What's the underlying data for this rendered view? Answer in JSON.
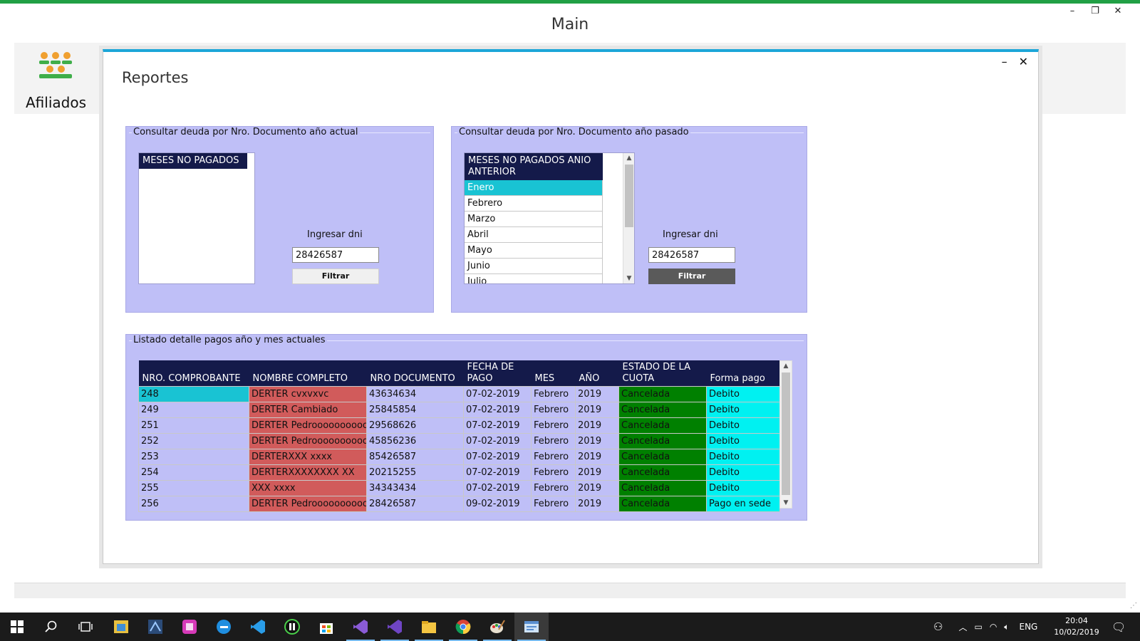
{
  "app": {
    "title": "Main",
    "controls": {
      "minimize": "–",
      "restore": "❐",
      "close": "✕"
    }
  },
  "menu": {
    "items": [
      {
        "label": "Afiliados",
        "icon": "people-group-icon"
      }
    ],
    "colors": {
      "icon_orange": "#f0a030",
      "icon_green": "#3fae49"
    }
  },
  "child": {
    "title": "Reportes",
    "controls": {
      "minimize": "–",
      "close": "✕"
    },
    "accent": "#1ca6d8"
  },
  "group_current": {
    "title": "Consultar deuda por Nro. Documento año actual",
    "list_header": "MESES NO PAGADOS",
    "items": [],
    "dni_label": "Ingresar dni",
    "dni_value": "28426587",
    "filter_label": "Filtrar"
  },
  "group_previous": {
    "title": "Consultar deuda por Nro. Documento año pasado",
    "list_header": "MESES NO PAGADOS ANIO ANTERIOR",
    "items": [
      "Enero",
      "Febrero",
      "Marzo",
      "Abril",
      "Mayo",
      "Junio",
      "Julio"
    ],
    "selected_index": 0,
    "dni_label": "Ingresar dni",
    "dni_value": "28426587",
    "filter_label": "Filtrar"
  },
  "group_list": {
    "title": "Listado detalle  pagos año y mes actuales",
    "columns": [
      "NRO. COMPROBANTE",
      "NOMBRE COMPLETO",
      "NRO DOCUMENTO",
      "FECHA DE PAGO",
      "MES",
      "AÑO",
      "ESTADO DE LA CUOTA",
      "Forma pago"
    ],
    "rows": [
      [
        "248",
        "DERTER cvxvxvc",
        "43634634",
        "07-02-2019",
        "Febrero",
        "2019",
        "Cancelada",
        "Debito"
      ],
      [
        "249",
        "DERTER Cambiado",
        "25845854",
        "07-02-2019",
        "Febrero",
        "2019",
        "Cancelada",
        "Debito"
      ],
      [
        "251",
        "DERTER Pedroooooooooo",
        "29568626",
        "07-02-2019",
        "Febrero",
        "2019",
        "Cancelada",
        "Debito"
      ],
      [
        "252",
        "DERTER Pedroooooooooo",
        "45856236",
        "07-02-2019",
        "Febrero",
        "2019",
        "Cancelada",
        "Debito"
      ],
      [
        "253",
        "DERTERXXX xxxx",
        "85426587",
        "07-02-2019",
        "Febrero",
        "2019",
        "Cancelada",
        "Debito"
      ],
      [
        "254",
        "DERTERXXXXXXXX XX",
        "20215255",
        "07-02-2019",
        "Febrero",
        "2019",
        "Cancelada",
        "Debito"
      ],
      [
        "255",
        "XXX xxxx",
        "34343434",
        "07-02-2019",
        "Febrero",
        "2019",
        "Cancelada",
        "Debito"
      ],
      [
        "256",
        "DERTER Pedroooooooooo",
        "28426587",
        "09-02-2019",
        "Febrero",
        "2019",
        "Cancelada",
        "Pago en sede"
      ]
    ],
    "selected_row": 0,
    "colors": {
      "name_bg": "#d15b5b",
      "estado_bg": "#008000",
      "forma_bg": "#00f1f1",
      "header_bg": "#141a4a",
      "selected_bg": "#19c3d3"
    }
  },
  "taskbar": {
    "apps": [
      "start-icon",
      "search-icon",
      "task-view-icon",
      "app-icon-1",
      "app-icon-2",
      "app-icon-3",
      "edge-icon",
      "vscode-icon",
      "app-icon-4",
      "store-icon",
      "visual-studio-icon",
      "visual-studio-2-icon",
      "file-explorer-icon",
      "chrome-icon",
      "paint-icon",
      "window-app-icon"
    ],
    "tray": {
      "language": "ENG",
      "time": "20:04",
      "date": "10/02/2019"
    }
  }
}
